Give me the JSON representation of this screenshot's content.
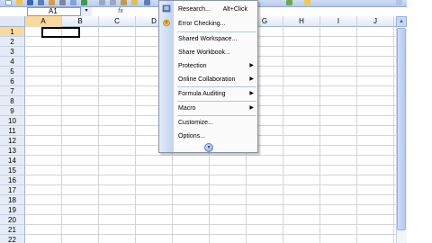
{
  "name_box": {
    "value": "A1",
    "arrow": "▾"
  },
  "formula_bar": {
    "fx_icon": "fx-icon"
  },
  "columns": [
    "A",
    "B",
    "C",
    "D",
    "E",
    "F",
    "G",
    "H",
    "I",
    "J"
  ],
  "rows": [
    "1",
    "2",
    "3",
    "4",
    "5",
    "6",
    "7",
    "8",
    "9",
    "10",
    "11",
    "12",
    "13",
    "14",
    "15",
    "16",
    "17",
    "18",
    "19",
    "20",
    "21",
    "22"
  ],
  "active_cell": "A1",
  "menu": {
    "items": [
      {
        "label": "Research...",
        "shortcut": "Alt+Click",
        "icon": "research-icon"
      },
      {
        "label": "Error Checking...",
        "icon": "error-checking-icon"
      },
      {
        "label": "Shared Workspace..."
      },
      {
        "label": "Share Workbook..."
      },
      {
        "label": "Protection",
        "submenu": true
      },
      {
        "label": "Online Collaboration",
        "submenu": true
      },
      {
        "label": "Formula Auditing",
        "submenu": true
      },
      {
        "label": "Macro",
        "submenu": true
      },
      {
        "label": "Customize..."
      },
      {
        "label": "Options..."
      }
    ],
    "expand_icon": "chevron-double-down-icon",
    "submenu_arrow": "▶"
  },
  "colors": {
    "selected_header": "#f9d99f",
    "menu_gutter": "#c2d3f0",
    "grid_line": "#d4d4d4"
  }
}
